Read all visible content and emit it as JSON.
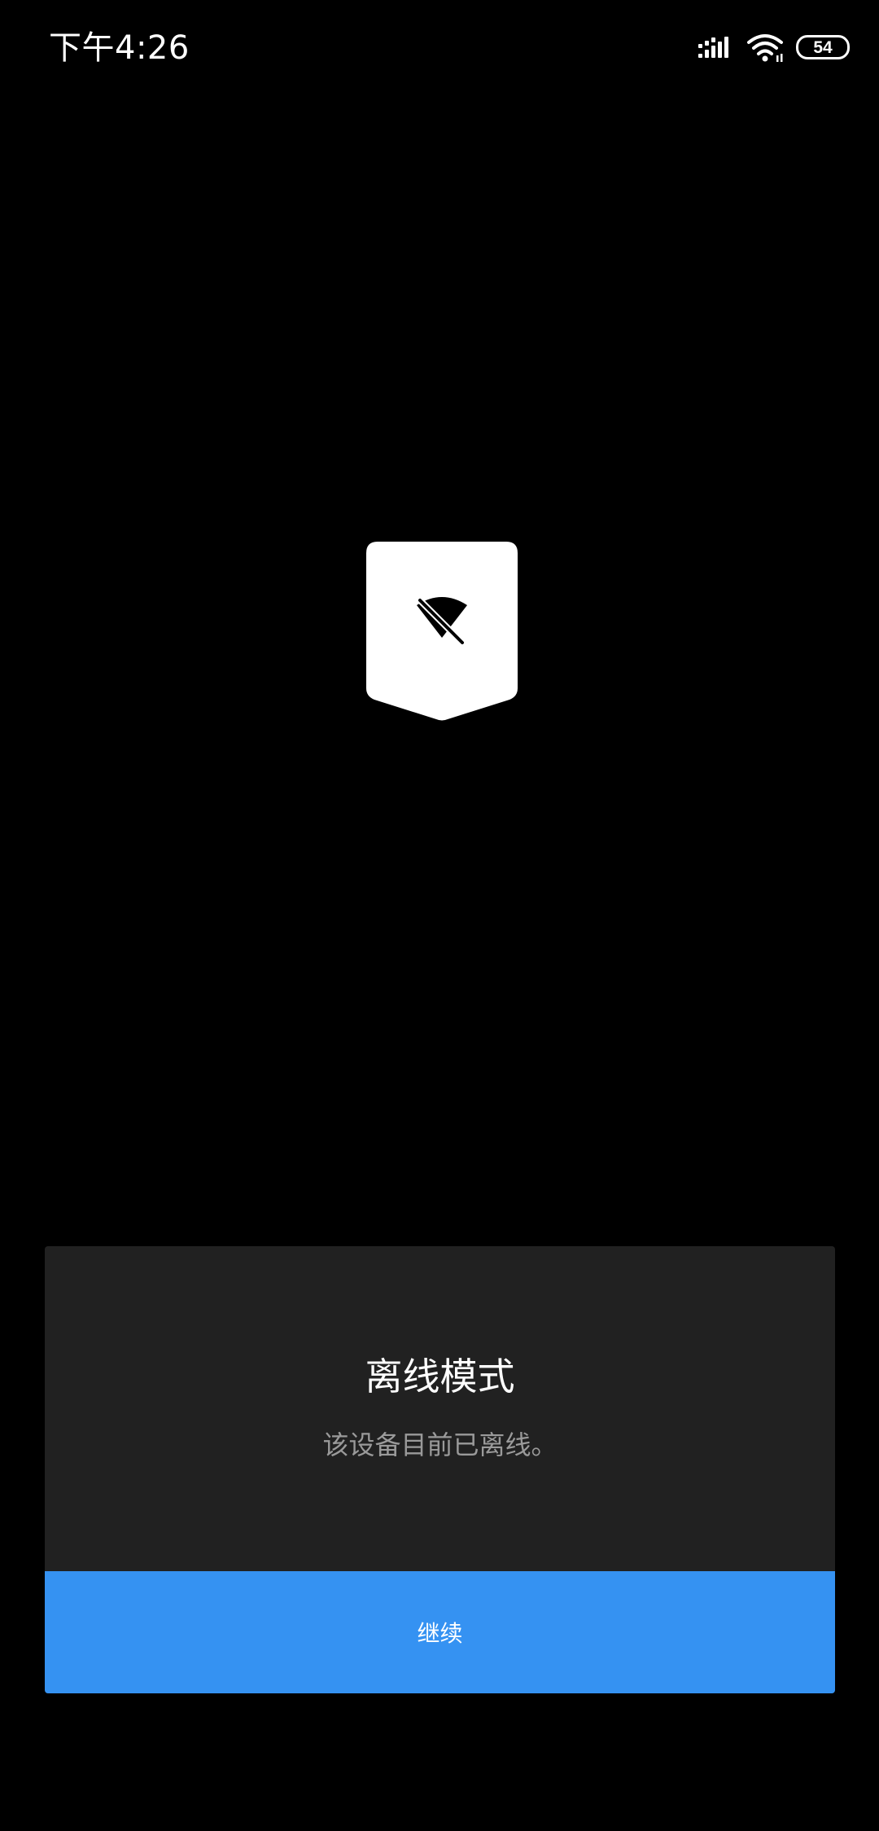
{
  "status_bar": {
    "time": "下午4:26",
    "battery_level": "54",
    "icons": [
      "signal-icon",
      "wifi-icon",
      "battery-icon"
    ]
  },
  "badge": {
    "icon": "wifi-off-icon"
  },
  "card": {
    "title": "离线模式",
    "message": "该设备目前已离线。",
    "button_label": "继续"
  },
  "colors": {
    "background": "#000000",
    "card": "#212121",
    "accent": "#3592f2",
    "message_text": "#9a9a9a"
  }
}
